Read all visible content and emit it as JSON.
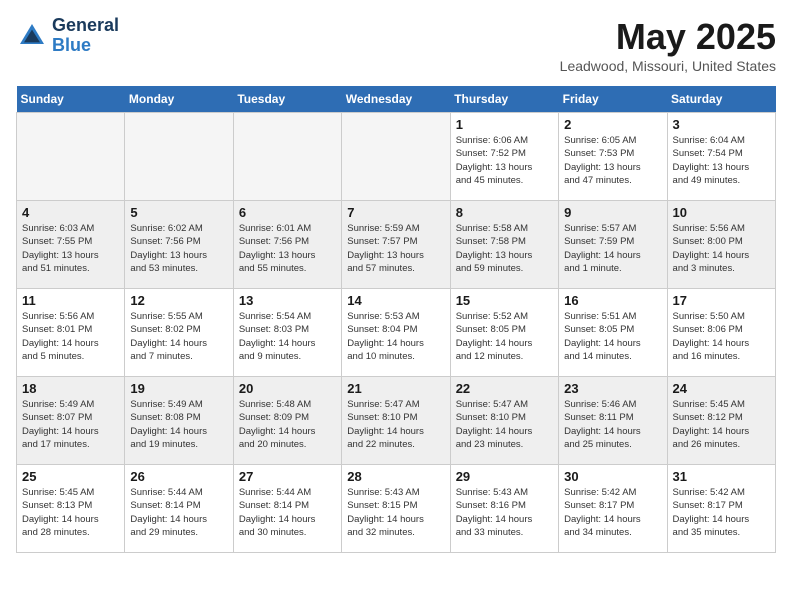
{
  "header": {
    "logo": {
      "general": "General",
      "blue": "Blue"
    },
    "title": "May 2025",
    "location": "Leadwood, Missouri, United States"
  },
  "days_of_week": [
    "Sunday",
    "Monday",
    "Tuesday",
    "Wednesday",
    "Thursday",
    "Friday",
    "Saturday"
  ],
  "weeks": [
    {
      "shade": "white",
      "days": [
        {
          "num": "",
          "info": "",
          "empty": true
        },
        {
          "num": "",
          "info": "",
          "empty": true
        },
        {
          "num": "",
          "info": "",
          "empty": true
        },
        {
          "num": "",
          "info": "",
          "empty": true
        },
        {
          "num": "1",
          "info": "Sunrise: 6:06 AM\nSunset: 7:52 PM\nDaylight: 13 hours\nand 45 minutes.",
          "empty": false
        },
        {
          "num": "2",
          "info": "Sunrise: 6:05 AM\nSunset: 7:53 PM\nDaylight: 13 hours\nand 47 minutes.",
          "empty": false
        },
        {
          "num": "3",
          "info": "Sunrise: 6:04 AM\nSunset: 7:54 PM\nDaylight: 13 hours\nand 49 minutes.",
          "empty": false
        }
      ]
    },
    {
      "shade": "gray",
      "days": [
        {
          "num": "4",
          "info": "Sunrise: 6:03 AM\nSunset: 7:55 PM\nDaylight: 13 hours\nand 51 minutes.",
          "empty": false
        },
        {
          "num": "5",
          "info": "Sunrise: 6:02 AM\nSunset: 7:56 PM\nDaylight: 13 hours\nand 53 minutes.",
          "empty": false
        },
        {
          "num": "6",
          "info": "Sunrise: 6:01 AM\nSunset: 7:56 PM\nDaylight: 13 hours\nand 55 minutes.",
          "empty": false
        },
        {
          "num": "7",
          "info": "Sunrise: 5:59 AM\nSunset: 7:57 PM\nDaylight: 13 hours\nand 57 minutes.",
          "empty": false
        },
        {
          "num": "8",
          "info": "Sunrise: 5:58 AM\nSunset: 7:58 PM\nDaylight: 13 hours\nand 59 minutes.",
          "empty": false
        },
        {
          "num": "9",
          "info": "Sunrise: 5:57 AM\nSunset: 7:59 PM\nDaylight: 14 hours\nand 1 minute.",
          "empty": false
        },
        {
          "num": "10",
          "info": "Sunrise: 5:56 AM\nSunset: 8:00 PM\nDaylight: 14 hours\nand 3 minutes.",
          "empty": false
        }
      ]
    },
    {
      "shade": "white",
      "days": [
        {
          "num": "11",
          "info": "Sunrise: 5:56 AM\nSunset: 8:01 PM\nDaylight: 14 hours\nand 5 minutes.",
          "empty": false
        },
        {
          "num": "12",
          "info": "Sunrise: 5:55 AM\nSunset: 8:02 PM\nDaylight: 14 hours\nand 7 minutes.",
          "empty": false
        },
        {
          "num": "13",
          "info": "Sunrise: 5:54 AM\nSunset: 8:03 PM\nDaylight: 14 hours\nand 9 minutes.",
          "empty": false
        },
        {
          "num": "14",
          "info": "Sunrise: 5:53 AM\nSunset: 8:04 PM\nDaylight: 14 hours\nand 10 minutes.",
          "empty": false
        },
        {
          "num": "15",
          "info": "Sunrise: 5:52 AM\nSunset: 8:05 PM\nDaylight: 14 hours\nand 12 minutes.",
          "empty": false
        },
        {
          "num": "16",
          "info": "Sunrise: 5:51 AM\nSunset: 8:05 PM\nDaylight: 14 hours\nand 14 minutes.",
          "empty": false
        },
        {
          "num": "17",
          "info": "Sunrise: 5:50 AM\nSunset: 8:06 PM\nDaylight: 14 hours\nand 16 minutes.",
          "empty": false
        }
      ]
    },
    {
      "shade": "gray",
      "days": [
        {
          "num": "18",
          "info": "Sunrise: 5:49 AM\nSunset: 8:07 PM\nDaylight: 14 hours\nand 17 minutes.",
          "empty": false
        },
        {
          "num": "19",
          "info": "Sunrise: 5:49 AM\nSunset: 8:08 PM\nDaylight: 14 hours\nand 19 minutes.",
          "empty": false
        },
        {
          "num": "20",
          "info": "Sunrise: 5:48 AM\nSunset: 8:09 PM\nDaylight: 14 hours\nand 20 minutes.",
          "empty": false
        },
        {
          "num": "21",
          "info": "Sunrise: 5:47 AM\nSunset: 8:10 PM\nDaylight: 14 hours\nand 22 minutes.",
          "empty": false
        },
        {
          "num": "22",
          "info": "Sunrise: 5:47 AM\nSunset: 8:10 PM\nDaylight: 14 hours\nand 23 minutes.",
          "empty": false
        },
        {
          "num": "23",
          "info": "Sunrise: 5:46 AM\nSunset: 8:11 PM\nDaylight: 14 hours\nand 25 minutes.",
          "empty": false
        },
        {
          "num": "24",
          "info": "Sunrise: 5:45 AM\nSunset: 8:12 PM\nDaylight: 14 hours\nand 26 minutes.",
          "empty": false
        }
      ]
    },
    {
      "shade": "white",
      "days": [
        {
          "num": "25",
          "info": "Sunrise: 5:45 AM\nSunset: 8:13 PM\nDaylight: 14 hours\nand 28 minutes.",
          "empty": false
        },
        {
          "num": "26",
          "info": "Sunrise: 5:44 AM\nSunset: 8:14 PM\nDaylight: 14 hours\nand 29 minutes.",
          "empty": false
        },
        {
          "num": "27",
          "info": "Sunrise: 5:44 AM\nSunset: 8:14 PM\nDaylight: 14 hours\nand 30 minutes.",
          "empty": false
        },
        {
          "num": "28",
          "info": "Sunrise: 5:43 AM\nSunset: 8:15 PM\nDaylight: 14 hours\nand 32 minutes.",
          "empty": false
        },
        {
          "num": "29",
          "info": "Sunrise: 5:43 AM\nSunset: 8:16 PM\nDaylight: 14 hours\nand 33 minutes.",
          "empty": false
        },
        {
          "num": "30",
          "info": "Sunrise: 5:42 AM\nSunset: 8:17 PM\nDaylight: 14 hours\nand 34 minutes.",
          "empty": false
        },
        {
          "num": "31",
          "info": "Sunrise: 5:42 AM\nSunset: 8:17 PM\nDaylight: 14 hours\nand 35 minutes.",
          "empty": false
        }
      ]
    }
  ]
}
